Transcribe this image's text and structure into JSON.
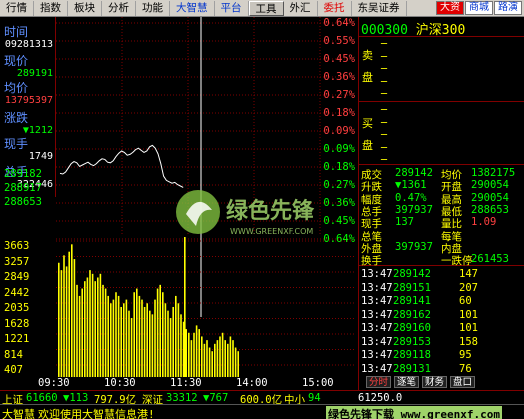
{
  "menu": {
    "items": [
      "行情",
      "指数",
      "板块",
      "分析",
      "功能",
      "大智慧",
      "平台",
      "工具",
      "外汇",
      "委托",
      "东吴证券"
    ],
    "right_buttons": [
      "大资",
      "商城",
      "路演"
    ]
  },
  "left": {
    "time_label": "时间",
    "time_value": "09281313",
    "price_label": "现价",
    "price_value": "289191",
    "avg_label": "均价",
    "avg_value": "13795397",
    "change_label": "涨跌",
    "change_value": "▼1212",
    "hand_label": "现手",
    "hand_value": "1749",
    "total_label": "总手",
    "total_value": "322446",
    "price_ticks": [
      "289182",
      "288917",
      "288653"
    ],
    "vol_ticks": [
      "3663",
      "3257",
      "2849",
      "2442",
      "2035",
      "1628",
      "1221",
      "814",
      "407"
    ]
  },
  "chart": {
    "pct_labels": [
      "0.64%",
      "0.55%",
      "0.45%",
      "0.36%",
      "0.27%",
      "0.18%",
      "0.09%",
      "0.09%",
      "0.18%",
      "0.27%",
      "0.36%",
      "0.45%",
      "0.64%"
    ],
    "time_axis": [
      "09:30",
      "10:30",
      "11:30",
      "14:00",
      "15:00"
    ],
    "price_line": [
      1.2,
      1.18,
      1.25,
      1.4,
      1.55,
      1.62,
      1.58,
      1.45,
      1.5,
      1.55,
      1.6,
      1.52,
      1.48,
      1.55,
      1.65,
      1.72,
      1.7,
      1.6,
      1.58,
      1.65,
      1.8,
      1.92,
      2.0,
      1.95,
      1.85,
      1.88,
      1.95,
      2.05,
      2.1,
      2.02,
      1.95,
      2.0,
      2.15,
      2.2,
      2.1,
      1.9,
      1.55,
      1.1,
      0.95,
      0.9,
      0.85,
      0.88,
      0.8,
      0.75,
      0.7
    ],
    "volume": [
      3100,
      2900,
      3300,
      3000,
      3400,
      3600,
      3200,
      2500,
      2200,
      2400,
      2600,
      2700,
      2900,
      2800,
      2600,
      2700,
      2800,
      2500,
      2400,
      2200,
      2000,
      2100,
      2300,
      2200,
      1900,
      2000,
      2100,
      1800,
      1600,
      2300,
      2400,
      2200,
      2100,
      1900,
      2000,
      1800,
      1700,
      2100,
      2400,
      2500,
      2300,
      2000,
      1800,
      1600,
      1900,
      2200,
      2000,
      1700,
      1500,
      1300,
      1200,
      1000,
      1200,
      1400,
      1300,
      1100,
      900,
      1000,
      800,
      700,
      900,
      1000,
      1100,
      1200,
      1000,
      900,
      1100,
      1000,
      800,
      700
    ],
    "spike_label": "3663"
  },
  "right": {
    "code": "000300",
    "name": "沪深300",
    "sell_label": [
      "卖",
      "盘"
    ],
    "buy_label": [
      "买",
      "盘"
    ],
    "stats": [
      {
        "l1": "成交",
        "v1": "289142",
        "l2": "均价",
        "v2": "1382175"
      },
      {
        "l1": "升跌",
        "v1": "▼1361",
        "l2": "开盘",
        "v2": "290054"
      },
      {
        "l1": "幅度",
        "v1": "0.47%",
        "l2": "最高",
        "v2": "290054"
      },
      {
        "l1": "总手",
        "v1": "397937",
        "l2": "最低",
        "v2": "288653"
      },
      {
        "l1": "现手",
        "v1": "137",
        "l2": "量比",
        "v2": "1.09"
      },
      {
        "l1": "总笔",
        "v1": "",
        "l2": "每笔",
        "v2": ""
      },
      {
        "l1": "外盘",
        "v1": "397937",
        "l2": "内盘",
        "v2": ""
      },
      {
        "l1": "换手",
        "v1": "",
        "l2": "一跌停",
        "v2": "261453"
      }
    ],
    "ticks": [
      {
        "t": "13:47",
        "p": "289142",
        "v": "147"
      },
      {
        "t": "13:47",
        "p": "289151",
        "v": "207"
      },
      {
        "t": "13:47",
        "p": "289141",
        "v": "60"
      },
      {
        "t": "13:47",
        "p": "289162",
        "v": "101"
      },
      {
        "t": "13:47",
        "p": "289160",
        "v": "101"
      },
      {
        "t": "13:47",
        "p": "289153",
        "v": "158"
      },
      {
        "t": "13:47",
        "p": "289118",
        "v": "95"
      },
      {
        "t": "13:47",
        "p": "289131",
        "v": "76"
      }
    ],
    "tabs": [
      "分时",
      "逐笔",
      "财务",
      "盘口"
    ]
  },
  "status": {
    "sh_label": "上证",
    "sh_value": "61660",
    "sh_change": "▼113",
    "sh_amount": "797.9亿",
    "sz_label": "深证",
    "sz_value": "33312",
    "sz_change": "▼767",
    "sz_amount": "600.0亿",
    "zx_label": "中小",
    "zx_value": "94",
    "tail": "61250.0",
    "msg_app": "大智慧",
    "msg_text": "欢迎使用大智慧信息港!",
    "watermark_site": "绿色先锋下载 www.greenxf.com"
  }
}
